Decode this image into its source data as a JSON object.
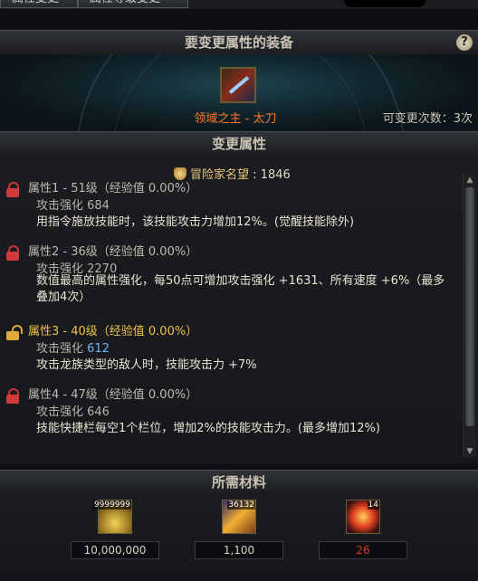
{
  "tabs": [
    "属性变更",
    "属性等级变更"
  ],
  "equip_header": "要变更属性的装备",
  "help": "?",
  "equipment": {
    "icon": "weapon-katana-icon",
    "name": "领域之主 - 太刀",
    "change_count_label": "可变更次数：3次"
  },
  "attr_header": "变更属性",
  "fame": {
    "label": "冒险家名望",
    "value": "1846"
  },
  "attributes": [
    {
      "title": "属性1 - 51级（经验值 0.00%）",
      "locked": true,
      "stat": "攻击强化 684",
      "desc": "用指令施放技能时，该技能攻击力增加12%。(觉醒技能除外)"
    },
    {
      "title": "属性2 - 36级（经验值 0.00%）",
      "locked": true,
      "stat": "攻击强化 2270",
      "desc": "数值最高的属性强化，每50点可增加攻击强化 +1631、所有速度 +6%（最多叠加4次）"
    },
    {
      "title": "属性3 - 40级（经验值 0.00%）",
      "locked": false,
      "stat_label": "攻击强化",
      "stat_value": "612",
      "desc": "攻击龙族类型的敌人时，技能攻击力 +7%"
    },
    {
      "title": "属性4 - 47级（经验值 0.00%）",
      "locked": true,
      "stat": "攻击强化 646",
      "desc": "技能快捷栏每空1个栏位，增加2%的技能攻击力。(最多增加12%)"
    }
  ],
  "materials_header": "所需材料",
  "materials": [
    {
      "icon": "gold-coins-icon",
      "badge": "9999999",
      "qty": "10,000,000"
    },
    {
      "icon": "crystal-icon",
      "badge": "36132",
      "qty": "1,100"
    },
    {
      "icon": "fire-orb-icon",
      "badge": "14",
      "qty": "26"
    }
  ]
}
